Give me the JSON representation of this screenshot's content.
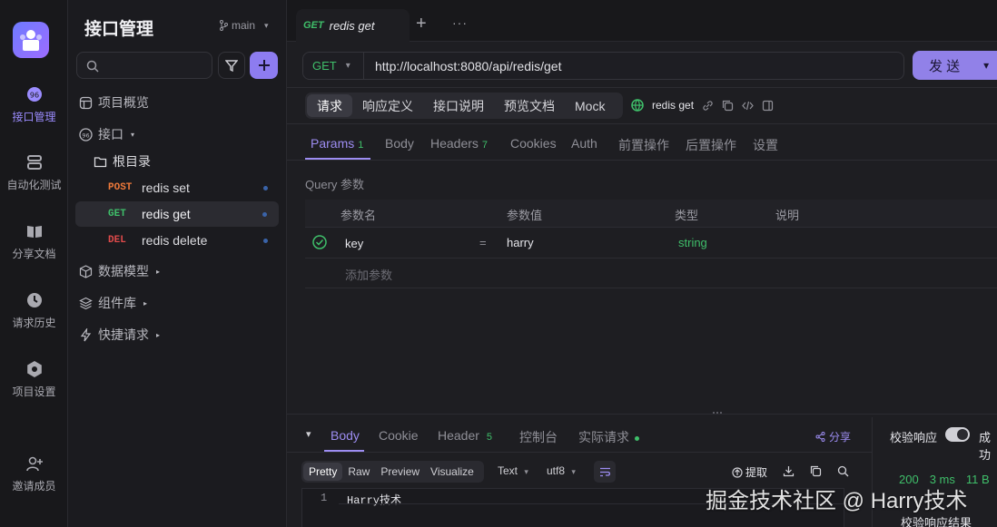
{
  "rail": {
    "items": [
      {
        "label": "接口管理"
      },
      {
        "label": "自动化测试"
      },
      {
        "label": "分享文档"
      },
      {
        "label": "请求历史"
      },
      {
        "label": "项目设置"
      },
      {
        "label": "邀请成员"
      }
    ]
  },
  "sidebar": {
    "title": "接口管理",
    "branch": "main",
    "tree": {
      "overview": "项目概览",
      "interfaces": "接口",
      "root_dir": "根目录",
      "endpoints": [
        {
          "method": "POST",
          "name": "redis set",
          "color": "#f07a3a"
        },
        {
          "method": "GET",
          "name": "redis get",
          "color": "#3fbf6a"
        },
        {
          "method": "DEL",
          "name": "redis delete",
          "color": "#e04b4b"
        }
      ],
      "data_models": "数据模型",
      "components": "组件库",
      "quick_requests": "快捷请求"
    }
  },
  "tabbar": {
    "active_tab_method": "GET",
    "active_tab_name": "redis get",
    "plus": "+",
    "more": "···"
  },
  "request": {
    "method": "GET",
    "url": "http://localhost:8080/api/redis/get",
    "send_label": "发 送"
  },
  "modes": {
    "items": [
      "请求",
      "响应定义",
      "接口说明",
      "预览文档",
      "Mock"
    ],
    "name": "redis get"
  },
  "param_tabs": {
    "params": "Params",
    "params_count": "1",
    "body": "Body",
    "headers": "Headers",
    "headers_count": "7",
    "cookies": "Cookies",
    "auth": "Auth",
    "pre": "前置操作",
    "post": "后置操作",
    "settings": "设置"
  },
  "query": {
    "section_title": "Query 参数",
    "columns": [
      "参数名",
      "参数值",
      "类型",
      "说明"
    ],
    "rows": [
      {
        "name": "key",
        "eq": "=",
        "value": "harry",
        "type": "string",
        "desc": ""
      }
    ],
    "add_placeholder": "添加参数"
  },
  "response": {
    "tabs": {
      "body": "Body",
      "cookie": "Cookie",
      "header": "Header",
      "header_count": "5",
      "console": "控制台",
      "actual": "实际请求"
    },
    "share": "分享",
    "validate": "校验响应",
    "success": "成功",
    "formats": [
      "Pretty",
      "Raw",
      "Preview",
      "Visualize"
    ],
    "text_select": "Text",
    "encoding_select": "utf8",
    "extract": "提取",
    "status": "200",
    "time": "3 ms",
    "size": "11 B",
    "validate_result": "校验响应结果",
    "line_no": "1",
    "line_text": "Harry技术"
  },
  "watermark": "掘金技术社区 @ Harry技术"
}
